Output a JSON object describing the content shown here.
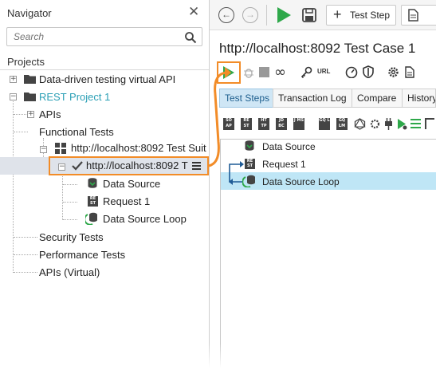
{
  "navigator": {
    "title": "Navigator",
    "search_placeholder": "Search",
    "projects_label": "Projects",
    "tree": {
      "project1": "Data-driven testing virtual API",
      "project2": "REST Project 1",
      "apis": "APIs",
      "functional_tests": "Functional Tests",
      "suite": "http://localhost:8092 Test Suit",
      "testcase": "http://localhost:8092 T",
      "data_source": "Data Source",
      "request": "Request 1",
      "data_source_loop": "Data Source Loop",
      "security_tests": "Security Tests",
      "performance_tests": "Performance Tests",
      "apis_virtual": "APIs (Virtual)"
    }
  },
  "toolbar": {
    "test_step_label": "Test Step"
  },
  "editor": {
    "title": "http://localhost:8092 Test Case 1",
    "tabs": [
      "Test Steps",
      "Transaction Log",
      "Compare",
      "History"
    ],
    "url_icon_label": "URL",
    "step_icon_labels": [
      "SO AP",
      "RE ST",
      "HT TP",
      "JD BC",
      "J MS",
      "GQ L",
      "GQ LM"
    ],
    "steps": [
      "Data Source",
      "Request 1",
      "Data Source Loop"
    ]
  },
  "colors": {
    "accent_orange": "#f28c28",
    "project_teal": "#2a9fb5",
    "run_green": "#2ea84a",
    "selection_blue": "#bfe6f6",
    "tab_active": "#cfe6f5"
  }
}
